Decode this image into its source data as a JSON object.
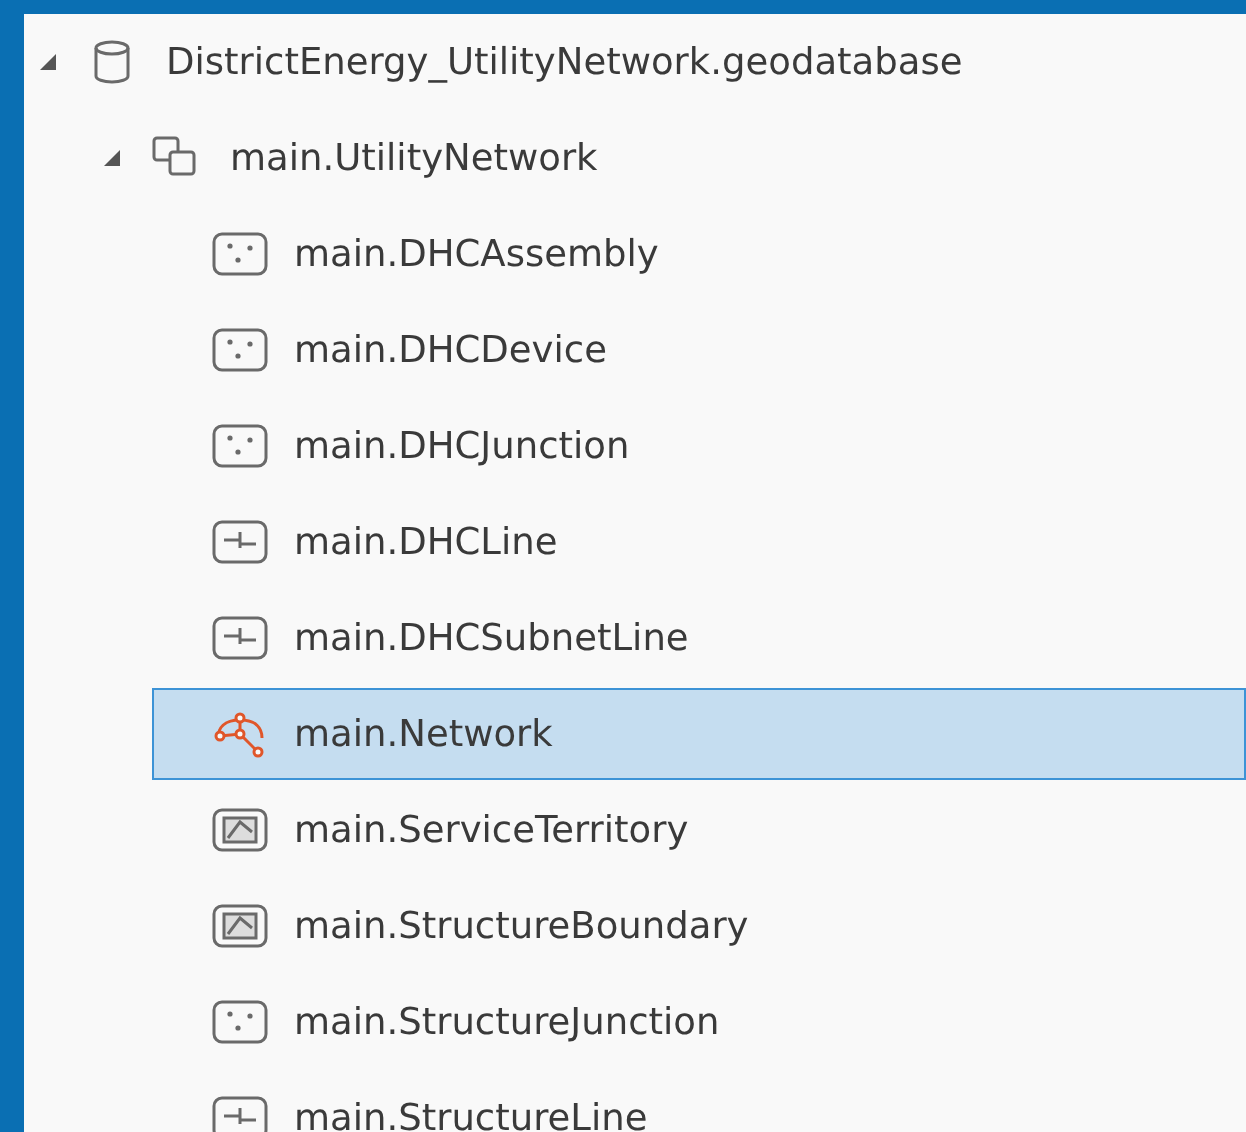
{
  "tree": [
    {
      "label": "DistrictEnergy_UtilityNetwork.geodatabase",
      "kind": "geodatabase",
      "expanded": true,
      "selected": false,
      "children": [
        {
          "label": "main.UtilityNetwork",
          "kind": "dataset",
          "expanded": true,
          "selected": false,
          "children": [
            {
              "label": "main.DHCAssembly",
              "kind": "point",
              "selected": false
            },
            {
              "label": "main.DHCDevice",
              "kind": "point",
              "selected": false
            },
            {
              "label": "main.DHCJunction",
              "kind": "point",
              "selected": false
            },
            {
              "label": "main.DHCLine",
              "kind": "line",
              "selected": false
            },
            {
              "label": "main.DHCSubnetLine",
              "kind": "line",
              "selected": false
            },
            {
              "label": "main.Network",
              "kind": "network",
              "selected": true
            },
            {
              "label": "main.ServiceTerritory",
              "kind": "polygon",
              "selected": false
            },
            {
              "label": "main.StructureBoundary",
              "kind": "polygon",
              "selected": false
            },
            {
              "label": "main.StructureJunction",
              "kind": "point",
              "selected": false
            },
            {
              "label": "main.StructureLine",
              "kind": "line",
              "selected": false
            }
          ]
        }
      ]
    }
  ]
}
